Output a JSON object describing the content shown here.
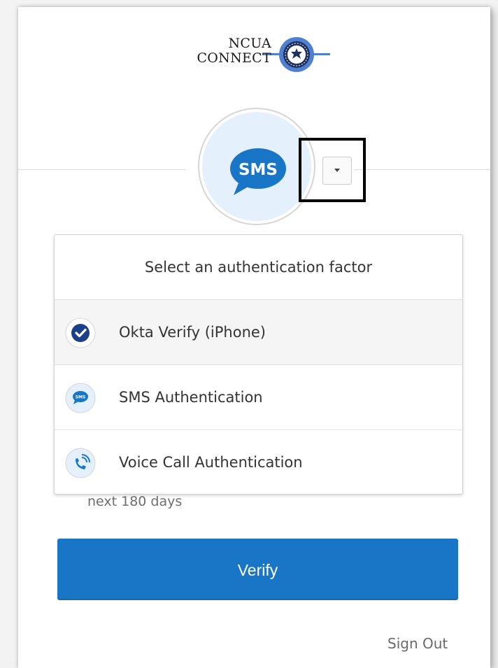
{
  "logo": {
    "line1": "NCUA",
    "line2": "CONNECT",
    "seal_icon": "ncua-seal-icon"
  },
  "factor": {
    "current_icon_text": "SMS",
    "icon": "sms-bubble-icon"
  },
  "dropdown": {
    "title": "Select an authentication factor",
    "items": [
      {
        "label": "Okta Verify (iPhone)",
        "icon": "okta-verify-icon"
      },
      {
        "label": "SMS Authentication",
        "icon": "sms-icon"
      },
      {
        "label": "Voice Call Authentication",
        "icon": "voice-call-icon"
      }
    ]
  },
  "note_text": "next 180 days",
  "verify_label": "Verify",
  "signout_label": "Sign Out",
  "colors": {
    "primary": "#1976c7",
    "sms_blue": "#1976c7",
    "icon_bg": "#e4f0fb"
  }
}
